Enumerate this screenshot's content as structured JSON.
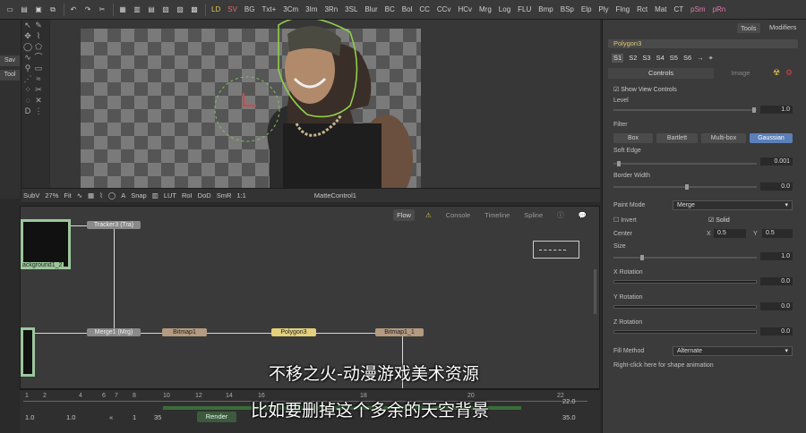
{
  "topbar": {
    "left_tools": [
      "File",
      "Copy",
      "Paste",
      "Undo",
      "Redo",
      "Cut"
    ],
    "view_labels": [
      "LD",
      "SV",
      "BG",
      "Txt+",
      "3Cm",
      "3Im",
      "3Rn",
      "3SL",
      "Blur",
      "BC",
      "Bol",
      "CC",
      "CCv",
      "HCv",
      "Mrg",
      "Log",
      "FLU",
      "Bmp",
      "BSp",
      "Elp",
      "Ply",
      "Flng",
      "Rct",
      "Mat",
      "CT",
      "pSm",
      "pRn"
    ]
  },
  "left_side": {
    "sav_label": "Sav",
    "tool_label": "Tool"
  },
  "viewer_toolbar": {
    "subv": "SubV",
    "zoom": "27%",
    "fit": "Fit",
    "snap": "Snap",
    "lut": "LUT",
    "roi": "RoI",
    "dod": "DoD",
    "smr": "SmR",
    "ratio": "1:1",
    "view_name": "MatteControl1"
  },
  "flow": {
    "tabs": [
      "Flow",
      "Console",
      "Timeline",
      "Spline"
    ],
    "active_tab": "Flow",
    "nodes": {
      "tracker": "Tracker3 (Tra)",
      "background": "ackground1_2",
      "merge": "Merge1 (Mrg)",
      "bitmap1": "Bitmap1",
      "polygon3": "Polygon3",
      "bitmap1_1": "Bitmap1_1"
    }
  },
  "timeline": {
    "ticks": [
      "1",
      "2",
      "4",
      "6",
      "7",
      "8",
      "10",
      "12",
      "14",
      "16",
      "18",
      "20",
      "22"
    ],
    "start": "1.0",
    "render_start": "1.0",
    "current_frame": "1",
    "end_frame": "35",
    "render_label": "Render",
    "right_values": [
      "22.0",
      "35.0"
    ]
  },
  "panel": {
    "tabs": [
      "Tools",
      "Modifiers"
    ],
    "node_title": "Polygon3",
    "subtabs": [
      "S1",
      "S2",
      "S3",
      "S4",
      "S5",
      "S6"
    ],
    "section_tabs": [
      "Controls",
      "Image"
    ],
    "show_view_controls": "Show View Controls",
    "level_label": "Level",
    "level_value": "1.0",
    "filter_label": "Filter",
    "filter_options": [
      "Box",
      "Bartlett",
      "Multi-box",
      "Gaussian"
    ],
    "filter_selected": "Gaussian",
    "soft_edge_label": "Soft Edge",
    "soft_edge_value": "0.001",
    "border_width_label": "Border Width",
    "border_width_value": "0.0",
    "paint_mode_label": "Paint Mode",
    "paint_mode_value": "Merge",
    "invert_label": "Invert",
    "solid_label": "Solid",
    "center_label": "Center",
    "center_x_label": "X",
    "center_x": "0.5",
    "center_y_label": "Y",
    "center_y": "0.5",
    "size_label": "Size",
    "size_value": "1.0",
    "x_rotation_label": "X Rotation",
    "x_rotation_value": "0.0",
    "y_rotation_label": "Y Rotation",
    "y_rotation_value": "0.0",
    "z_rotation_label": "Z Rotation",
    "z_rotation_value": "0.0",
    "fill_method_label": "Fill Method",
    "fill_method_value": "Alternate",
    "footer_hint": "Right-click here for shape animation"
  },
  "subtitles": {
    "line1": "不移之火-动漫游戏美术资源",
    "line2": "比如要删掉这个多余的天空背景"
  },
  "colors": {
    "accent_yellow": "#e4d07a",
    "selected_blue": "#5b7fb8",
    "node_tan": "#b49a80",
    "polygon_green": "#8fcf4a"
  }
}
